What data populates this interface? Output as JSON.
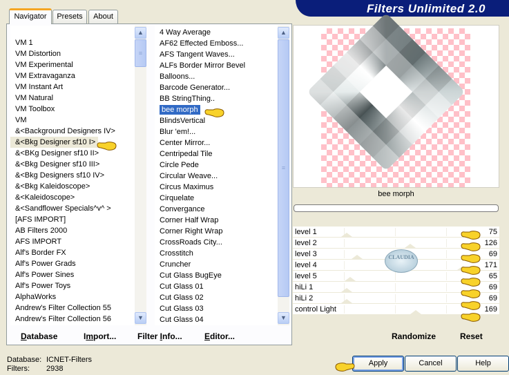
{
  "app": {
    "title": "Filters Unlimited 2.0"
  },
  "tabs": [
    {
      "label": "Navigator",
      "active": true
    },
    {
      "label": "Presets",
      "active": false
    },
    {
      "label": "About",
      "active": false
    }
  ],
  "categories": {
    "items": [
      "VM 1",
      "VM Distortion",
      "VM Experimental",
      "VM Extravaganza",
      "VM Instant Art",
      "VM Natural",
      "VM Toolbox",
      "VM",
      "&<Background Designers IV>",
      "&<Bkg Designer sf10 I>",
      "&<BKg Designer sf10 II>",
      "&<Bkg Designer sf10 III>",
      "&<Bkg Designers sf10 IV>",
      "&<Bkg Kaleidoscope>",
      "&<Kaleidoscope>",
      "&<Sandflower Specials^v^ >",
      "[AFS IMPORT]",
      "AB Filters 2000",
      "AFS IMPORT",
      "Alf's Border FX",
      "Alf's Power Grads",
      "Alf's Power Sines",
      "Alf's Power Toys",
      "AlphaWorks",
      "Andrew's Filter Collection 55",
      "Andrew's Filter Collection 56"
    ],
    "selected": "&<Bkg Designer sf10 I>"
  },
  "filters": {
    "items": [
      "4 Way Average",
      "AF62 Effected Emboss...",
      "AFS Tangent Waves...",
      "ALFs Border Mirror Bevel",
      "Balloons...",
      "Barcode Generator...",
      "BB StringThing..",
      "bee morph",
      "BlindsVertical",
      "Blur 'em!...",
      "Center Mirror...",
      "Centripedal Tile",
      "Circle Pede",
      "Circular Weave...",
      "Circus Maximus",
      "Cirquelate",
      "Convergance",
      "Corner Half Wrap",
      "Corner Right Wrap",
      "CrossRoads City...",
      "Crosstitch",
      "Cruncher",
      "Cut Glass  BugEye",
      "Cut Glass 01",
      "Cut Glass 02",
      "Cut Glass 03",
      "Cut Glass 04"
    ],
    "selected": "bee morph"
  },
  "preview": {
    "label": "bee morph",
    "progress": 0
  },
  "params": [
    {
      "label": "level 1",
      "value": "75"
    },
    {
      "label": "level 2",
      "value": "126"
    },
    {
      "label": "level 3",
      "value": "69"
    },
    {
      "label": "level 4",
      "value": "171"
    },
    {
      "label": "level 5",
      "value": "65"
    },
    {
      "label": "hiLi 1",
      "value": "69"
    },
    {
      "label": "hiLi 2",
      "value": "69"
    },
    {
      "label": "control Light",
      "value": "169"
    }
  ],
  "watermark": {
    "text": "CLAUDIA"
  },
  "toolbar": {
    "database": {
      "pre": "",
      "u": "D",
      "post": "atabase"
    },
    "import": {
      "pre": "I",
      "u": "m",
      "post": "port..."
    },
    "filter_info": {
      "pre": "Filter ",
      "u": "I",
      "post": "nfo..."
    },
    "editor": {
      "pre": "",
      "u": "E",
      "post": "ditor..."
    },
    "randomize": "Randomize",
    "reset": "Reset"
  },
  "status": {
    "database_label": "Database:",
    "database_value": "ICNET-Filters",
    "filters_label": "Filters:",
    "filters_value": "2938"
  },
  "buttons": {
    "apply": "Apply",
    "cancel": "Cancel",
    "help": "Help"
  },
  "colors": {
    "banner": "#0a1e7a",
    "selection": "#316ac5",
    "checker": "#ffc0c8"
  }
}
